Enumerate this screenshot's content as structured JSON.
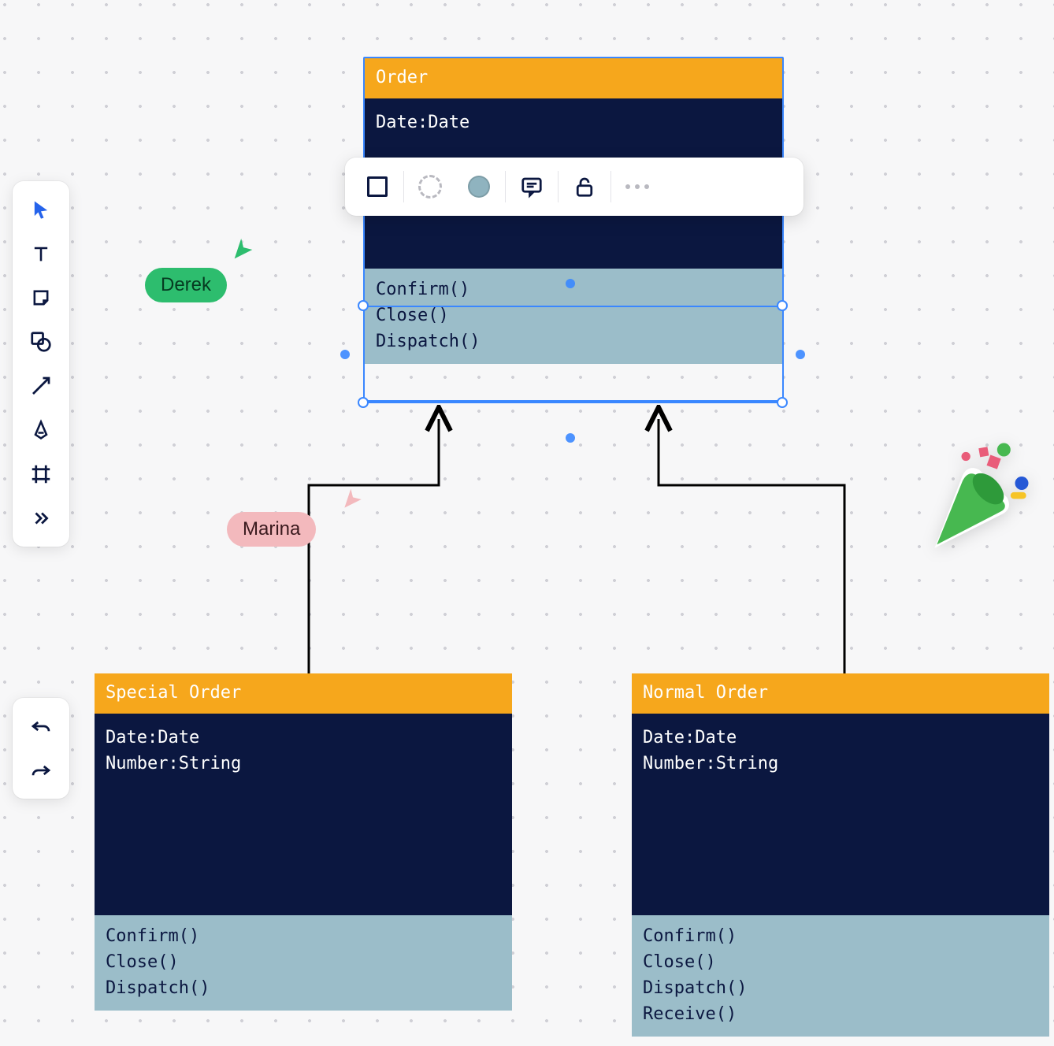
{
  "colors": {
    "header": "#f6a71c",
    "body": "#0b1740",
    "methods": "#9bbdc9",
    "selection": "#3a87ff"
  },
  "cards": {
    "order": {
      "title": "Order",
      "attrs": [
        "Date:Date"
      ],
      "methods": [
        "Confirm()",
        "Close()",
        "Dispatch()"
      ]
    },
    "special": {
      "title": "Special Order",
      "attrs": [
        "Date:Date",
        "Number:String"
      ],
      "methods": [
        "Confirm()",
        "Close()",
        "Dispatch()"
      ]
    },
    "normal": {
      "title": "Normal Order",
      "attrs": [
        "Date:Date",
        "Number:String"
      ],
      "methods": [
        "Confirm()",
        "Close()",
        "Dispatch()",
        "Receive()"
      ]
    }
  },
  "presence": {
    "derek": {
      "name": "Derek",
      "color": "#2dbd6e"
    },
    "marina": {
      "name": "Marina",
      "color": "#f3b9bd"
    }
  },
  "chart_data": {
    "type": "uml-class-diagram",
    "classes": [
      {
        "name": "Order",
        "attributes": [
          "Date:Date"
        ],
        "methods": [
          "Confirm()",
          "Close()",
          "Dispatch()"
        ]
      },
      {
        "name": "Special Order",
        "attributes": [
          "Date:Date",
          "Number:String"
        ],
        "methods": [
          "Confirm()",
          "Close()",
          "Dispatch()"
        ]
      },
      {
        "name": "Normal Order",
        "attributes": [
          "Date:Date",
          "Number:String"
        ],
        "methods": [
          "Confirm()",
          "Close()",
          "Dispatch()",
          "Receive()"
        ]
      }
    ],
    "relations": [
      {
        "from": "Special Order",
        "to": "Order",
        "type": "inheritance"
      },
      {
        "from": "Normal Order",
        "to": "Order",
        "type": "inheritance"
      }
    ],
    "selected": "Order",
    "collaborators": [
      "Derek",
      "Marina"
    ]
  }
}
